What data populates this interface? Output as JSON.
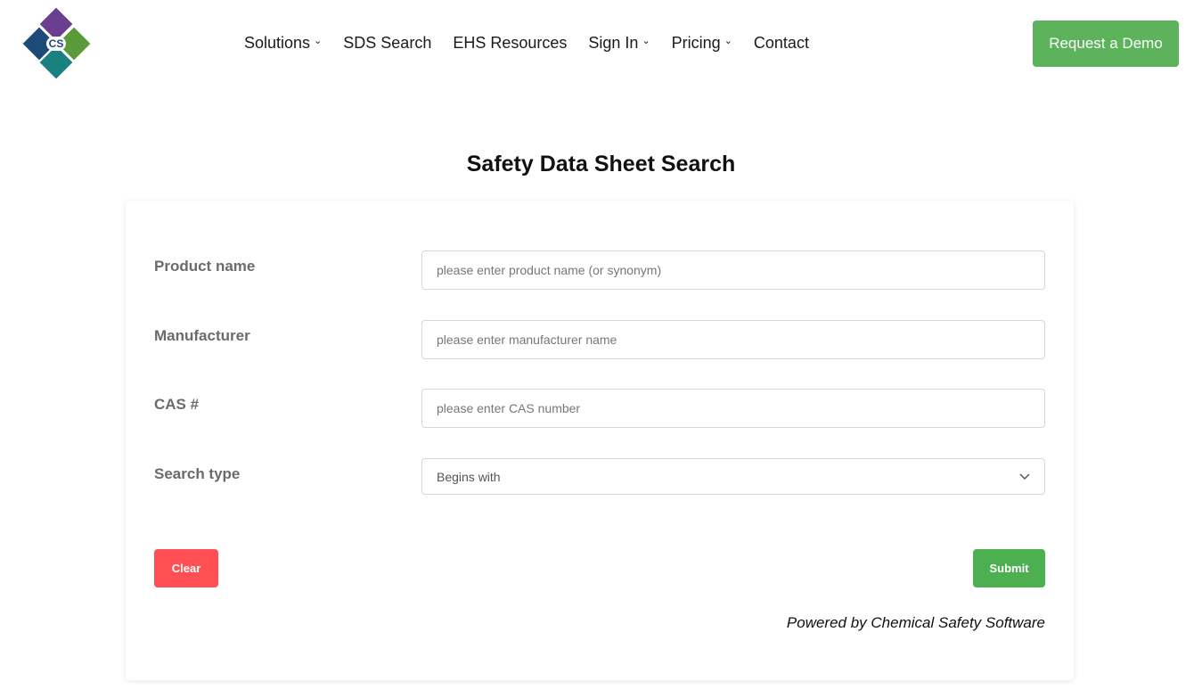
{
  "logo": {
    "text": "CS",
    "colors": [
      "#6b3f8f",
      "#1e4a7a",
      "#5a9a3a",
      "#1a8080"
    ]
  },
  "nav": [
    {
      "label": "Solutions",
      "dropdown": true
    },
    {
      "label": "SDS Search",
      "dropdown": false
    },
    {
      "label": "EHS Resources",
      "dropdown": false
    },
    {
      "label": "Sign In",
      "dropdown": true
    },
    {
      "label": "Pricing",
      "dropdown": true
    },
    {
      "label": "Contact",
      "dropdown": false
    }
  ],
  "header": {
    "demo_label": "Request a Demo",
    "demo_color": "#5cb35c"
  },
  "page": {
    "title": "Safety Data Sheet Search"
  },
  "form": {
    "product_label": "Product name",
    "product_placeholder": "please enter product name (or synonym)",
    "manufacturer_label": "Manufacturer",
    "manufacturer_placeholder": "please enter manufacturer name",
    "cas_label": "CAS #",
    "cas_placeholder": "please enter CAS number",
    "search_type_label": "Search type",
    "search_type_value": "Begins with",
    "clear_label": "Clear",
    "clear_color": "#ff4f55",
    "submit_label": "Submit",
    "submit_color": "#4caf50",
    "powered": "Powered by Chemical Safety Software"
  }
}
